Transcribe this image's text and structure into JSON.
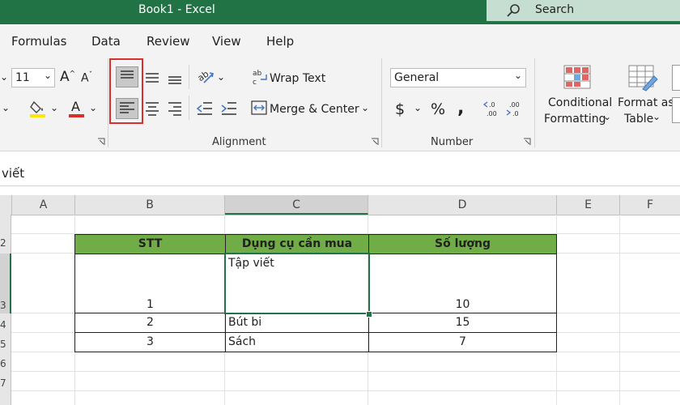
{
  "window": {
    "title": "Book1  -  Excel",
    "search_label": "Search"
  },
  "menu": [
    "Formulas",
    "Data",
    "Review",
    "View",
    "Help"
  ],
  "ribbon": {
    "font_size": "11",
    "wrap_text": "Wrap Text",
    "merge_center": "Merge & Center",
    "alignment_group": "Alignment",
    "number_format": "General",
    "number_group": "Number",
    "conditional_formatting": [
      "Conditional",
      "Formatting"
    ],
    "format_as_table": [
      "Format as",
      "Table"
    ]
  },
  "formula_bar": {
    "text": "viết"
  },
  "columns": [
    "A",
    "B",
    "C",
    "D",
    "E",
    "F"
  ],
  "rows": [
    "2",
    "3",
    "4",
    "5",
    "6",
    "7"
  ],
  "table": {
    "headers": [
      "STT",
      "Dụng cụ cần mua",
      "Số lượng"
    ],
    "rows": [
      {
        "stt": "1",
        "item": "Tập viết",
        "qty": "10"
      },
      {
        "stt": "2",
        "item": "Bút bi",
        "qty": "15"
      },
      {
        "stt": "3",
        "item": "Sách",
        "qty": "7"
      }
    ]
  },
  "colors": {
    "brand": "#217346",
    "header_fill": "#70ad47",
    "highlight": "#d9302c"
  }
}
